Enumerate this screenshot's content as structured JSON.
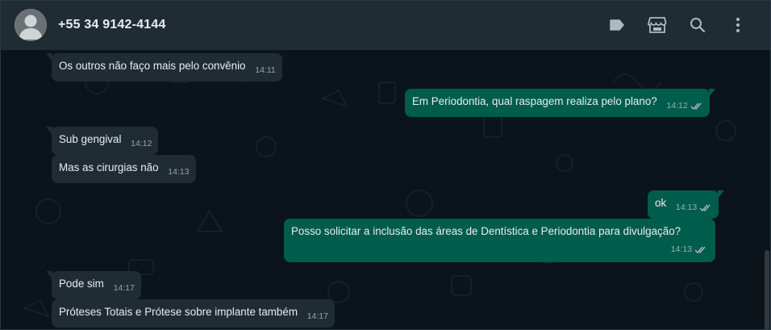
{
  "header": {
    "contact_name": "+55 34 9142-4144",
    "actions": [
      {
        "name": "label-icon"
      },
      {
        "name": "catalog-icon"
      },
      {
        "name": "search-icon"
      },
      {
        "name": "menu-icon"
      }
    ]
  },
  "messages": [
    {
      "id": "m1",
      "direction": "in",
      "text": "Os outros não faço mais pelo convênio",
      "time": "14:11"
    },
    {
      "id": "m2",
      "direction": "out",
      "text": "Em Periodontia, qual raspagem realiza pelo plano?",
      "time": "14:12",
      "status": "read"
    },
    {
      "id": "m3",
      "direction": "in",
      "text": "Sub gengival",
      "time": "14:12"
    },
    {
      "id": "m4",
      "direction": "in",
      "text": "Mas as cirurgias não",
      "time": "14:13"
    },
    {
      "id": "m5",
      "direction": "out",
      "text": "ok",
      "time": "14:13",
      "status": "read"
    },
    {
      "id": "m6",
      "direction": "out",
      "text": "Posso solicitar a inclusão das áreas de Dentística e Periodontia para divulgação?",
      "time": "14:13",
      "status": "read"
    },
    {
      "id": "m7",
      "direction": "in",
      "text": "Pode sim",
      "time": "14:17"
    },
    {
      "id": "m8",
      "direction": "in",
      "text": "Próteses Totais e Prótese sobre implante também",
      "time": "14:17"
    }
  ],
  "colors": {
    "background": "#0b141a",
    "header": "#202c33",
    "incoming_bubble": "#202c33",
    "outgoing_bubble": "#005c4b",
    "text": "#e9edef",
    "icon": "#aebac1"
  }
}
